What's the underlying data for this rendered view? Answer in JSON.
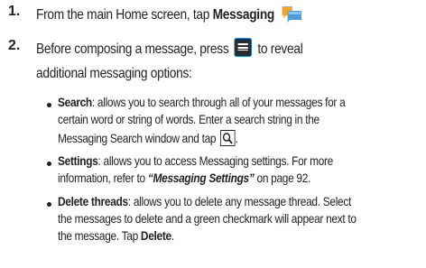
{
  "step1": {
    "number": "1.",
    "text_before": "From the main Home screen, tap ",
    "bold": "Messaging",
    "icon": "messaging-icon"
  },
  "step2": {
    "number": "2.",
    "line1_before": "Before composing a message, press ",
    "icon": "menu-icon",
    "line1_after": " to reveal",
    "line2": "additional messaging options:"
  },
  "bullets": {
    "search": {
      "term": "Search",
      "line1": ": allows you to search through all of your messages for a",
      "line2": "certain word or string of words. Enter a search string in the",
      "line3": "Messaging Search window and tap ",
      "icon": "search-icon",
      "line3_end": "."
    },
    "settings": {
      "term": "Settings",
      "line1": ": allows you to access Messaging settings. For more",
      "line2_before": "information, refer to ",
      "link": "“Messaging Settings”",
      "line2_after": "  on page 92."
    },
    "delete": {
      "term": "Delete threads",
      "line1": ": allows you to delete any message thread. Select",
      "line2": "the messages to delete and a green checkmark will appear next to",
      "line3_before": "the message. Tap ",
      "action": "Delete",
      "line3_end": "."
    }
  },
  "colors": {
    "text": "#231f20",
    "messaging_icon_back": "#f5a623",
    "messaging_icon_front": "#4d9de0",
    "menu_icon_bg": "#1e7fd6"
  }
}
